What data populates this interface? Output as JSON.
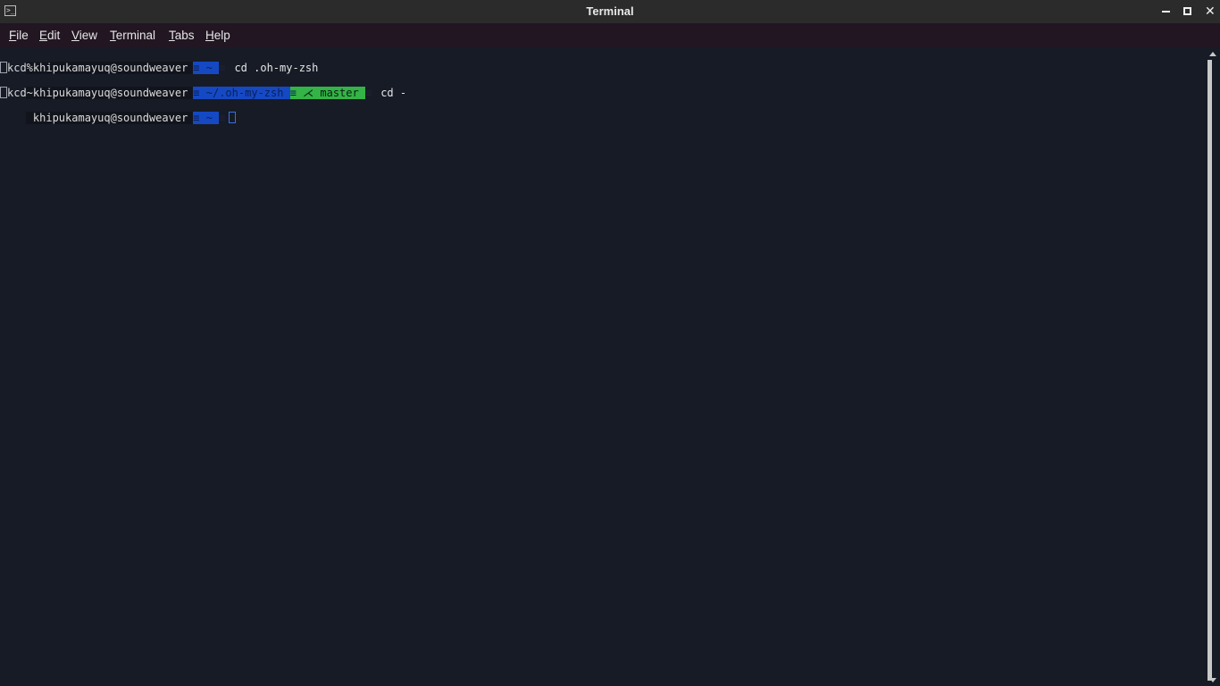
{
  "window": {
    "title": "Terminal",
    "icon": "terminal-icon"
  },
  "menu": [
    {
      "label": "File",
      "mnemonic": "F",
      "rest": "ile"
    },
    {
      "label": "Edit",
      "mnemonic": "E",
      "rest": "dit"
    },
    {
      "label": "View",
      "mnemonic": "V",
      "rest": "iew"
    },
    {
      "label": "Terminal",
      "mnemonic": "T",
      "rest": "erminal"
    },
    {
      "label": "Tabs",
      "mnemonic": "T",
      "rest": "abs"
    },
    {
      "label": "Help",
      "mnemonic": "H",
      "rest": "elp"
    }
  ],
  "terminal": {
    "prompt_user": "khipukamayuq@soundweaver",
    "lines": [
      {
        "user": "khipukamayuq@soundweaver",
        "dir": " ~ ",
        "git": "",
        "command": "cd .oh-my-zsh"
      },
      {
        "output": "kcd%"
      },
      {
        "user": "khipukamayuq@soundweaver",
        "dir": " ~/.oh-my-zsh ",
        "git": " ⋌ master ",
        "command": "cd -"
      },
      {
        "output": "kcd~"
      },
      {
        "user": "khipukamayuq@soundweaver",
        "dir": " ~ ",
        "git": "",
        "command": ""
      }
    ]
  },
  "colors": {
    "background": "#161b26",
    "dir_segment": "#1549c4",
    "git_segment": "#34b347",
    "menubar": "#211622",
    "titlebar": "#2b2b2b"
  }
}
